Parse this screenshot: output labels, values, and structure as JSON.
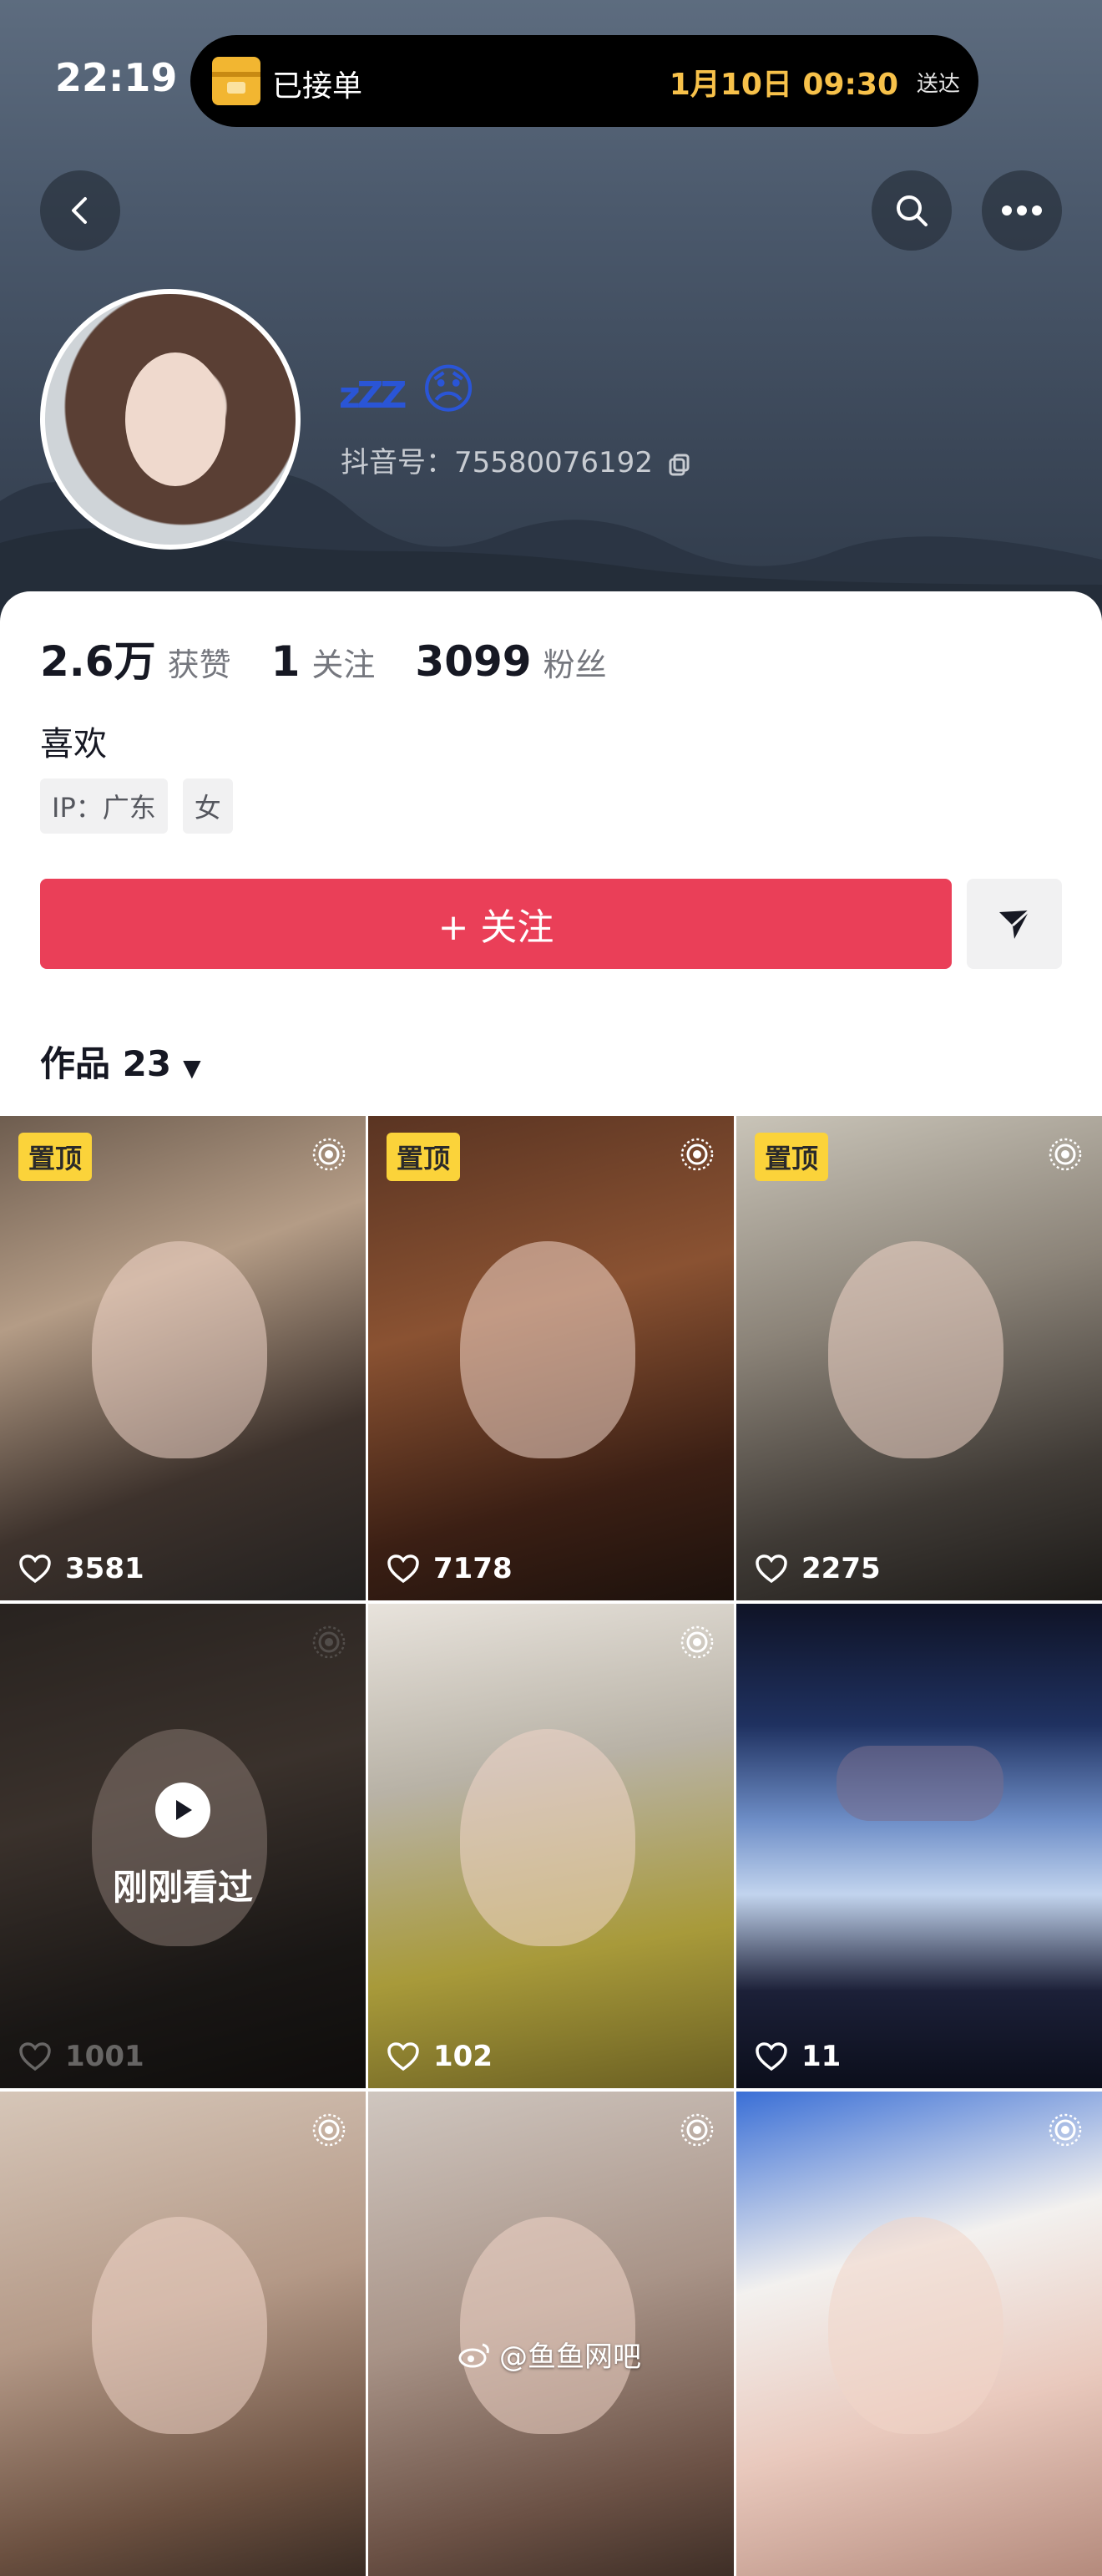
{
  "status_bar": {
    "time": "22:19",
    "island_label": "已接单",
    "island_eta": "1月10日 09:30",
    "island_suffix": "送达"
  },
  "nav": {
    "back_icon": "chevron-left-icon",
    "search_icon": "search-icon",
    "more_icon": "more-horizontal-icon"
  },
  "profile": {
    "nickname_emoji": "😞",
    "nickname_zz": "zZZ",
    "douyin_id": "抖音号：75580076192",
    "copy_icon": "copy-icon"
  },
  "stats": [
    {
      "value": "2.6万",
      "label": "获赞"
    },
    {
      "value": "1",
      "label": "关注"
    },
    {
      "value": "3099",
      "label": "粉丝"
    }
  ],
  "bio": "喜欢",
  "tags": [
    "IP：广东",
    "女"
  ],
  "follow_button": "+ 关注",
  "share_icon": "send-icon",
  "works": {
    "label": "作品 23",
    "caret": "▼"
  },
  "videos": [
    {
      "pinned": "置顶",
      "likes": "3581",
      "seen": "",
      "theme": "bunny"
    },
    {
      "pinned": "置顶",
      "likes": "7178",
      "seen": "",
      "theme": "bow"
    },
    {
      "pinned": "置顶",
      "likes": "2275",
      "seen": "",
      "theme": "devil"
    },
    {
      "pinned": "",
      "likes": "1001",
      "seen": "刚刚看过",
      "theme": "dark"
    },
    {
      "pinned": "",
      "likes": "102",
      "seen": "",
      "theme": "hanfu"
    },
    {
      "pinned": "",
      "likes": "11",
      "seen": "",
      "theme": "movie"
    },
    {
      "pinned": "",
      "likes": "",
      "seen": "",
      "theme": "closeup"
    },
    {
      "pinned": "",
      "likes": "",
      "seen": "",
      "theme": "roller"
    },
    {
      "pinned": "",
      "likes": "",
      "seen": "",
      "theme": "plush"
    }
  ],
  "watermark": "@鱼鱼网吧",
  "colors": {
    "accent": "#ea3f58",
    "pin": "#fbd33a",
    "id_text": "#c8ccd2"
  }
}
